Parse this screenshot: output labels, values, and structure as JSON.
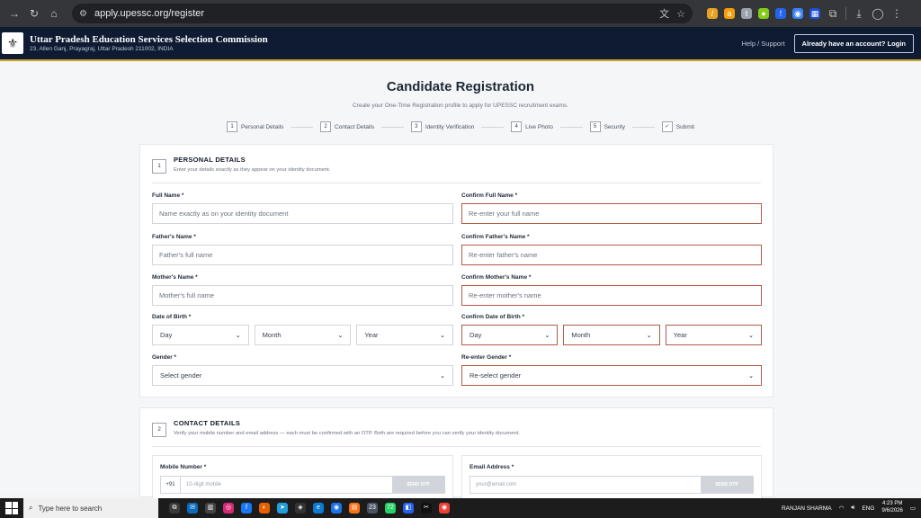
{
  "browser": {
    "url": "apply.upessc.org/register",
    "back_icon": "arrow-right-icon",
    "extensions": [
      {
        "name": "paper-extension",
        "color": "#e6a223",
        "glyph": "/"
      },
      {
        "name": "amazon-extension",
        "color": "#f59e0b",
        "glyph": "a"
      },
      {
        "name": "pin-extension",
        "color": "#9ca3af",
        "glyph": "t"
      },
      {
        "name": "map-extension",
        "color": "#84cc16",
        "glyph": "●"
      },
      {
        "name": "shield-extension",
        "color": "#2563eb",
        "glyph": "!"
      },
      {
        "name": "eye-extension",
        "color": "#3b82f6",
        "glyph": "◉"
      },
      {
        "name": "grid-extension",
        "color": "#1d4ed8",
        "glyph": "▦"
      }
    ]
  },
  "header": {
    "org_name": "Uttar Pradesh Education Services Selection Commission",
    "org_address": "23, Allen Ganj, Prayagraj, Uttar Pradesh 211002, INDIA",
    "help_label": "Help / Support",
    "login_label": "Already have an account? Login"
  },
  "page": {
    "title": "Candidate Registration",
    "subtitle": "Create your One-Time Registration profile to apply for UPESSC recruitment exams."
  },
  "steps": [
    {
      "num": "1",
      "label": "Personal Details"
    },
    {
      "num": "2",
      "label": "Contact Details"
    },
    {
      "num": "3",
      "label": "Identity Verification"
    },
    {
      "num": "4",
      "label": "Live Photo"
    },
    {
      "num": "5",
      "label": "Security"
    },
    {
      "num": "✓",
      "label": "Submit"
    }
  ],
  "personal": {
    "num": "1",
    "title": "PERSONAL DETAILS",
    "desc": "Enter your details exactly as they appear on your identity document.",
    "full_name_label": "Full Name *",
    "full_name_ph": "Name exactly as on your identity document",
    "confirm_full_name_label": "Confirm Full Name *",
    "confirm_full_name_ph": "Re-enter your full name",
    "father_label": "Father's Name *",
    "father_ph": "Father's full name",
    "confirm_father_label": "Confirm Father's Name *",
    "confirm_father_ph": "Re-enter father's name",
    "mother_label": "Mother's Name *",
    "mother_ph": "Mother's full name",
    "confirm_mother_label": "Confirm Mother's Name *",
    "confirm_mother_ph": "Re-enter mother's name",
    "dob_label": "Date of Birth *",
    "confirm_dob_label": "Confirm Date of Birth *",
    "day": "Day",
    "month": "Month",
    "year": "Year",
    "gender_label": "Gender *",
    "gender_ph": "Select gender",
    "confirm_gender_label": "Re-enter Gender *",
    "confirm_gender_ph": "Re-select gender"
  },
  "contact": {
    "num": "2",
    "title": "CONTACT DETAILS",
    "desc": "Verify your mobile number and email address — each must be confirmed with an OTP. Both are required before you can verify your identity document.",
    "mobile_label": "Mobile Number *",
    "mobile_prefix": "+91",
    "mobile_ph": "10-digit mobile",
    "email_label": "Email Address *",
    "email_ph": "your@email.com",
    "send_otp": "SEND OTP"
  },
  "taskbar": {
    "search_ph": "Type here to search",
    "user": "RANJAN SHARMA",
    "lang": "ENG",
    "time": "4:23 PM",
    "date": "9/6/2026",
    "apps": [
      {
        "name": "task-view-app",
        "color": "#3a3a3a",
        "glyph": "⧉"
      },
      {
        "name": "mail-app",
        "color": "#0b6cbd",
        "glyph": "✉"
      },
      {
        "name": "calendar-app",
        "color": "#444",
        "glyph": "▥"
      },
      {
        "name": "instagram-app",
        "color": "#d62976",
        "glyph": "◎"
      },
      {
        "name": "facebook-app",
        "color": "#1877f2",
        "glyph": "f"
      },
      {
        "name": "firefox-app",
        "color": "#e66000",
        "glyph": "◐"
      },
      {
        "name": "telegram-app",
        "color": "#229ed9",
        "glyph": "➤"
      },
      {
        "name": "capcut-app",
        "color": "#333",
        "glyph": "◈"
      },
      {
        "name": "edge-app",
        "color": "#0c7bd1",
        "glyph": "e"
      },
      {
        "name": "chrome-app",
        "color": "#1a73e8",
        "glyph": "◉"
      },
      {
        "name": "notes-app",
        "color": "#f97316",
        "glyph": "▤"
      },
      {
        "name": "files-app",
        "color": "#4b5563",
        "glyph": "23"
      },
      {
        "name": "whatsapp-app",
        "color": "#25d366",
        "glyph": "72"
      },
      {
        "name": "browser-app",
        "color": "#2563eb",
        "glyph": "◧"
      },
      {
        "name": "capcut-2-app",
        "color": "#111",
        "glyph": "✂"
      },
      {
        "name": "chrome-active-app",
        "color": "#ea4335",
        "glyph": "◉"
      }
    ]
  }
}
